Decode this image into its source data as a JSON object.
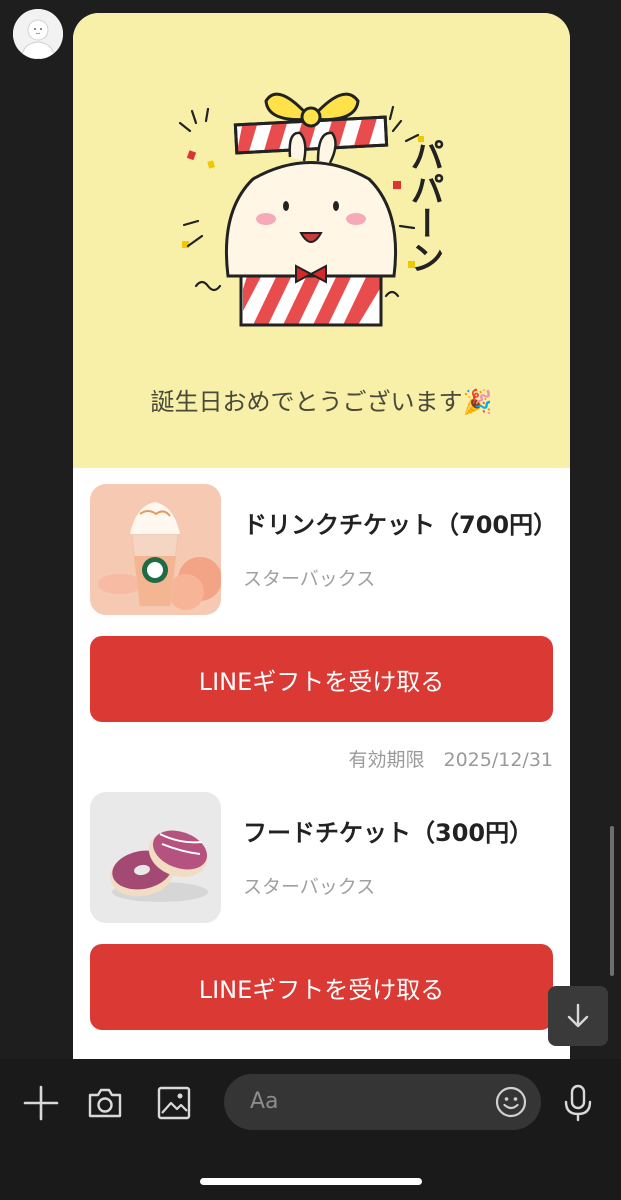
{
  "greeting": {
    "text": "誕生日おめでとうございます🎉",
    "sticker_text": "パパーン"
  },
  "gifts": [
    {
      "title": "ドリンクチケット（700円）",
      "shop": "スターバックス",
      "button_label": "LINEギフトを受け取る",
      "expiry": "有効期限　2025/12/31",
      "thumbnail": "peach-frappuccino"
    },
    {
      "title": "フードチケット（300円）",
      "shop": "スターバックス",
      "button_label": "LINEギフトを受け取る",
      "thumbnail": "pink-donut"
    }
  ],
  "input": {
    "placeholder": "Aa"
  },
  "icons": {
    "add": "plus-icon",
    "camera": "camera-icon",
    "image": "image-icon",
    "emoji": "smiley-icon",
    "mic": "microphone-icon",
    "scroll": "arrow-down-icon"
  },
  "colors": {
    "header_bg": "#f8f0a9",
    "button": "#da3a33",
    "background": "#1e1e1e"
  }
}
